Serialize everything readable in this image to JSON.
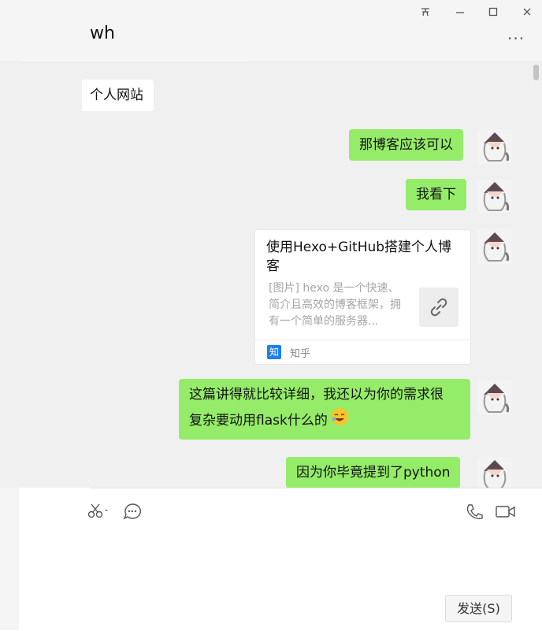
{
  "window": {
    "pin_icon": "pin-icon",
    "minimize": "—",
    "maximize": "☐",
    "close": "✕"
  },
  "header": {
    "title": "wh",
    "more": "···"
  },
  "messages": [
    {
      "side": "left",
      "text": "个人网站"
    },
    {
      "side": "right",
      "text": "那博客应该可以"
    },
    {
      "side": "right",
      "text": "我看下"
    },
    {
      "side": "right",
      "type": "link-card",
      "title": "使用Hexo+GitHub搭建个人博客",
      "description": "[图片] hexo 是一个快速、简介且高效的博客框架，拥有一个简单的服务器...",
      "source": "知乎"
    },
    {
      "side": "right",
      "text_line1": "这篇讲得就比较详细，我还以为你的需求很",
      "text_line2": "复杂要动用flask什么的",
      "emoji": "laughing-face-icon"
    },
    {
      "side": "right",
      "text": "因为你毕竟提到了python"
    }
  ],
  "toolbar": {
    "scissors_icon": "scissors-icon",
    "chat_icon": "chat-bubble-icon",
    "phone_icon": "phone-icon",
    "video_icon": "video-icon"
  },
  "send_button": "发送(S)"
}
